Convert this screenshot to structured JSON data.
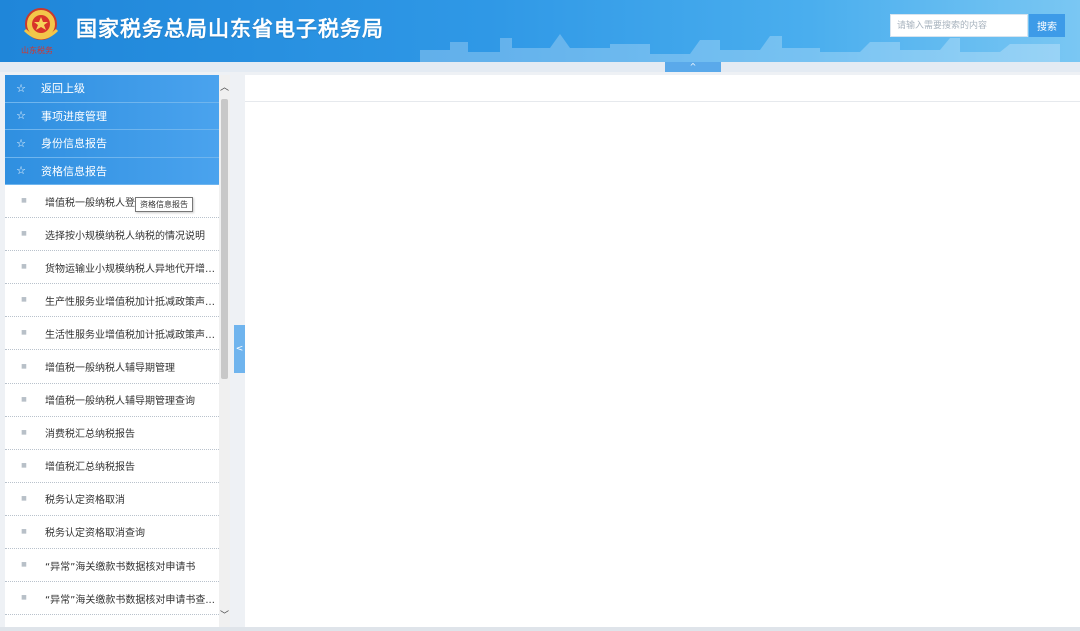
{
  "header": {
    "title": "国家税务总局山东省电子税务局",
    "logo_icon": "tax-emblem-icon",
    "colors": {
      "header_start": "#1f86d9",
      "header_end": "#7ac7f3",
      "accent": "#3d9be8"
    }
  },
  "search": {
    "placeholder": "请输入需要搜索的内容",
    "value": "",
    "button_label": "搜索"
  },
  "collapse_top": {
    "icon": "chevron-up-icon",
    "glyph": "^"
  },
  "sidebar": {
    "headers": [
      {
        "label": "返回上级",
        "icon": "star-outline-icon"
      },
      {
        "label": "事项进度管理",
        "icon": "star-outline-icon"
      },
      {
        "label": "身份信息报告",
        "icon": "star-outline-icon"
      },
      {
        "label": "资格信息报告",
        "icon": "star-outline-icon"
      }
    ],
    "items": [
      {
        "label": "增值税一般纳税人登记"
      },
      {
        "label": "选择按小规模纳税人纳税的情况说明"
      },
      {
        "label": "货物运输业小规模纳税人异地代开增值..."
      },
      {
        "label": "生产性服务业增值税加计抵减政策声明..."
      },
      {
        "label": "生活性服务业增值税加计抵减政策声明..."
      },
      {
        "label": "增值税一般纳税人辅导期管理"
      },
      {
        "label": "增值税一般纳税人辅导期管理查询"
      },
      {
        "label": "消费税汇总纳税报告"
      },
      {
        "label": "增值税汇总纳税报告"
      },
      {
        "label": "税务认定资格取消"
      },
      {
        "label": "税务认定资格取消查询"
      },
      {
        "label": "“异常”海关缴款书数据核对申请书"
      },
      {
        "label": "“异常”海关缴款书数据核对申请书查..."
      }
    ],
    "tooltip": "资格信息报告",
    "toggle_glyph": "<"
  }
}
